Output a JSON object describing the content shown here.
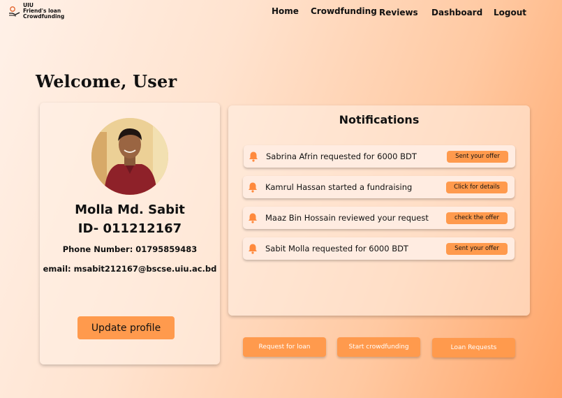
{
  "brand": {
    "line1": "UIU",
    "line2": "Friend's loan",
    "line3": "Crowdfunding",
    "icon": "hand-coin-icon"
  },
  "nav": {
    "home": "Home",
    "crowdfunding": "Crowdfunding",
    "reviews": "Reviews",
    "dashboard": "Dashboard",
    "logout": "Logout"
  },
  "welcome": "Welcome, User",
  "profile": {
    "name": "Molla Md. Sabit",
    "id": "ID- 011212167",
    "phone": "Phone Number: 01795859483",
    "email": "email: msabit212167@bscse.uiu.ac.bd",
    "update_label": "Update profile"
  },
  "notifications": {
    "title": "Notifications",
    "items": [
      {
        "text": "Sabrina Afrin requested for 6000 BDT",
        "action": "Sent your offer"
      },
      {
        "text": "Kamrul Hassan started a fundraising",
        "action": "Click for details"
      },
      {
        "text": "Maaz Bin Hossain reviewed your request",
        "action": "check the offer"
      },
      {
        "text": "Sabit Molla requested for 6000 BDT",
        "action": "Sent your offer"
      }
    ]
  },
  "actions": {
    "request_loan": "Request for loan",
    "start_crowdfunding": "Start crowdfunding",
    "loan_requests": "Loan Requests"
  },
  "colors": {
    "accent": "#ff9a4d",
    "bell": "#ff8a3d"
  }
}
